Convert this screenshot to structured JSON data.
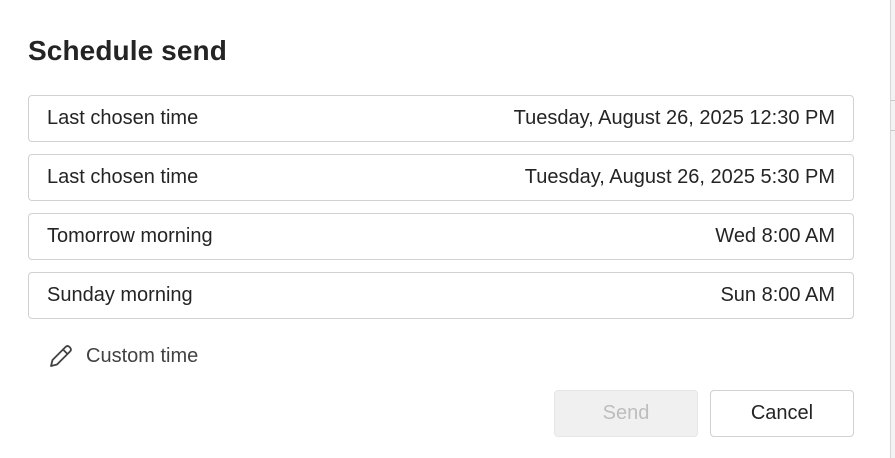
{
  "dialog": {
    "title": "Schedule send"
  },
  "options": [
    {
      "label": "Last chosen time",
      "time": "Tuesday, August 26, 2025 12:30 PM"
    },
    {
      "label": "Last chosen time",
      "time": "Tuesday, August 26, 2025 5:30 PM"
    },
    {
      "label": "Tomorrow morning",
      "time": "Wed 8:00 AM"
    },
    {
      "label": "Sunday morning",
      "time": "Sun 8:00 AM"
    }
  ],
  "custom_time": {
    "label": "Custom time",
    "icon": "pencil-icon"
  },
  "buttons": {
    "send_label": "Send",
    "send_state": "disabled",
    "cancel_label": "Cancel"
  },
  "colors": {
    "text": "#242424",
    "border": "#d1d1d1",
    "disabled_bg": "#f0f0f0",
    "disabled_text": "#bdbdbd"
  }
}
